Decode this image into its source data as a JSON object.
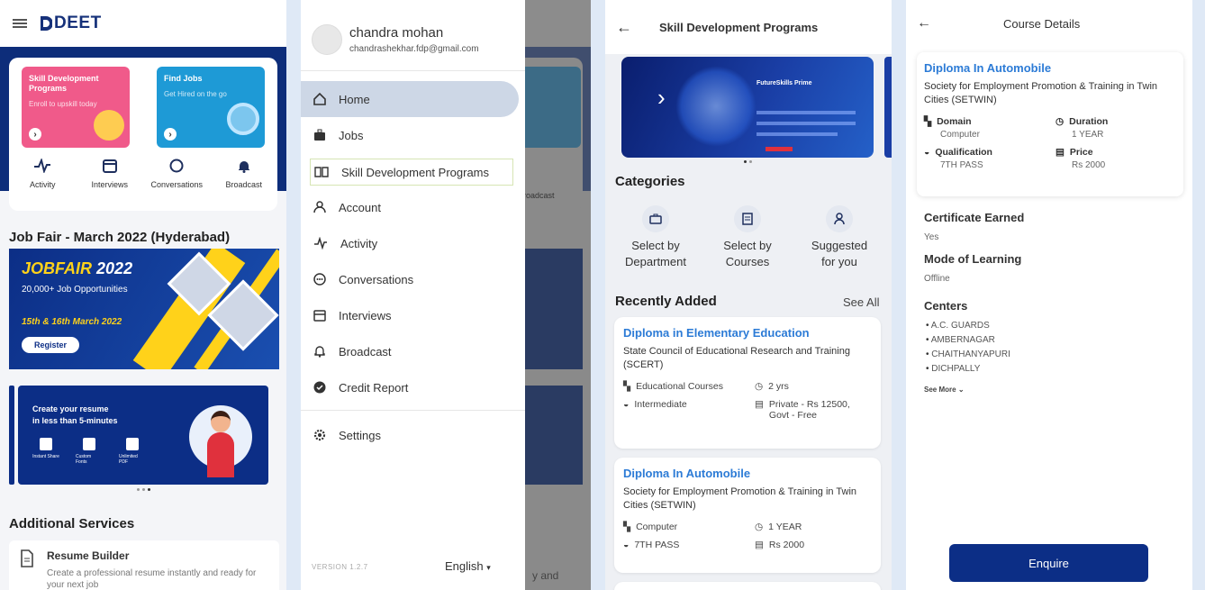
{
  "screen1": {
    "logo": "DEET",
    "cards": [
      {
        "title": "Skill Development Programs",
        "sub": "Enroll to upskill today",
        "color": "#f05a8a"
      },
      {
        "title": "Find Jobs",
        "sub": "Get Hired on the go",
        "color": "#1e9ad6"
      }
    ],
    "quick_icons": [
      {
        "label": "Activity",
        "icon": "activity-icon"
      },
      {
        "label": "Interviews",
        "icon": "calendar-icon"
      },
      {
        "label": "Conversations",
        "icon": "chat-icon"
      },
      {
        "label": "Broadcast",
        "icon": "bell-icon"
      }
    ],
    "jobfair_heading": "Job Fair - March 2022 (Hyderabad)",
    "jobfair_banner": {
      "title_a": "JOBFAIR",
      "title_b": "2022",
      "line": "20,000+ Job Opportunities",
      "dates": "15th & 16th March 2022",
      "button": "Register"
    },
    "resume_banner": {
      "line1": "Create your resume",
      "line2": "in less than 5-minutes",
      "items": [
        "Instant Share",
        "Custom Fonts",
        "Unlimited PDF"
      ]
    },
    "additional_heading": "Additional Services",
    "resume_builder": {
      "title": "Resume Builder",
      "desc": "Create a professional resume instantly and ready for your next job"
    }
  },
  "screen2": {
    "user_name": "chandra mohan",
    "user_email": "chandrashekhar.fdp@gmail.com",
    "menu": [
      {
        "label": "Home",
        "icon": "home-icon"
      },
      {
        "label": "Jobs",
        "icon": "briefcase-icon"
      },
      {
        "label": "Skill Development Programs",
        "icon": "book-icon"
      },
      {
        "label": "Account",
        "icon": "person-icon"
      },
      {
        "label": "Activity",
        "icon": "activity-icon"
      },
      {
        "label": "Conversations",
        "icon": "chat-icon"
      },
      {
        "label": "Interviews",
        "icon": "calendar-icon"
      },
      {
        "label": "Broadcast",
        "icon": "bell-icon"
      },
      {
        "label": "Credit Report",
        "icon": "check-circle-icon"
      },
      {
        "label": "Settings",
        "icon": "gear-icon"
      }
    ],
    "version": "VERSION 1.2.7",
    "language": "English",
    "peek_labels": [
      "roadcast",
      "y and"
    ]
  },
  "screen3": {
    "title": "Skill Development Programs",
    "banner_title": "FutureSkills Prime",
    "categories_heading": "Categories",
    "categories": [
      {
        "label": "Select by Department",
        "icon": "briefcase-icon"
      },
      {
        "label": "Select by Courses",
        "icon": "document-icon"
      },
      {
        "label": "Suggested for you",
        "icon": "person-icon"
      }
    ],
    "recent_heading": "Recently Added",
    "see_all": "See All",
    "courses": [
      {
        "title": "Diploma in Elementary Education",
        "org": "State Council of Educational Research and Training (SCERT)",
        "domain": "Educational Courses",
        "duration": "2 yrs",
        "qualification": "Intermediate",
        "price": "Private - Rs 12500, Govt - Free"
      },
      {
        "title": "Diploma In Automobile",
        "org": "Society for Employment Promotion & Training in Twin Cities (SETWIN)",
        "domain": "Computer",
        "duration": "1 YEAR",
        "qualification": "7TH PASS",
        "price": "Rs 2000"
      }
    ]
  },
  "screen4": {
    "title": "Course Details",
    "course": {
      "title": "Diploma In Automobile",
      "org": "Society for Employment Promotion & Training in Twin Cities (SETWIN)"
    },
    "fields": [
      {
        "label": "Domain",
        "value": "Computer"
      },
      {
        "label": "Duration",
        "value": "1 YEAR"
      },
      {
        "label": "Qualification",
        "value": "7TH PASS"
      },
      {
        "label": "Price",
        "value": "Rs 2000"
      }
    ],
    "certificate_label": "Certificate Earned",
    "certificate_value": "Yes",
    "mode_label": "Mode of Learning",
    "mode_value": "Offline",
    "centers_label": "Centers",
    "centers": [
      "A.C. GUARDS",
      "AMBERNAGAR",
      "CHAITHANYAPURI",
      "DICHPALLY"
    ],
    "see_more": "See More",
    "enquire": "Enquire"
  }
}
